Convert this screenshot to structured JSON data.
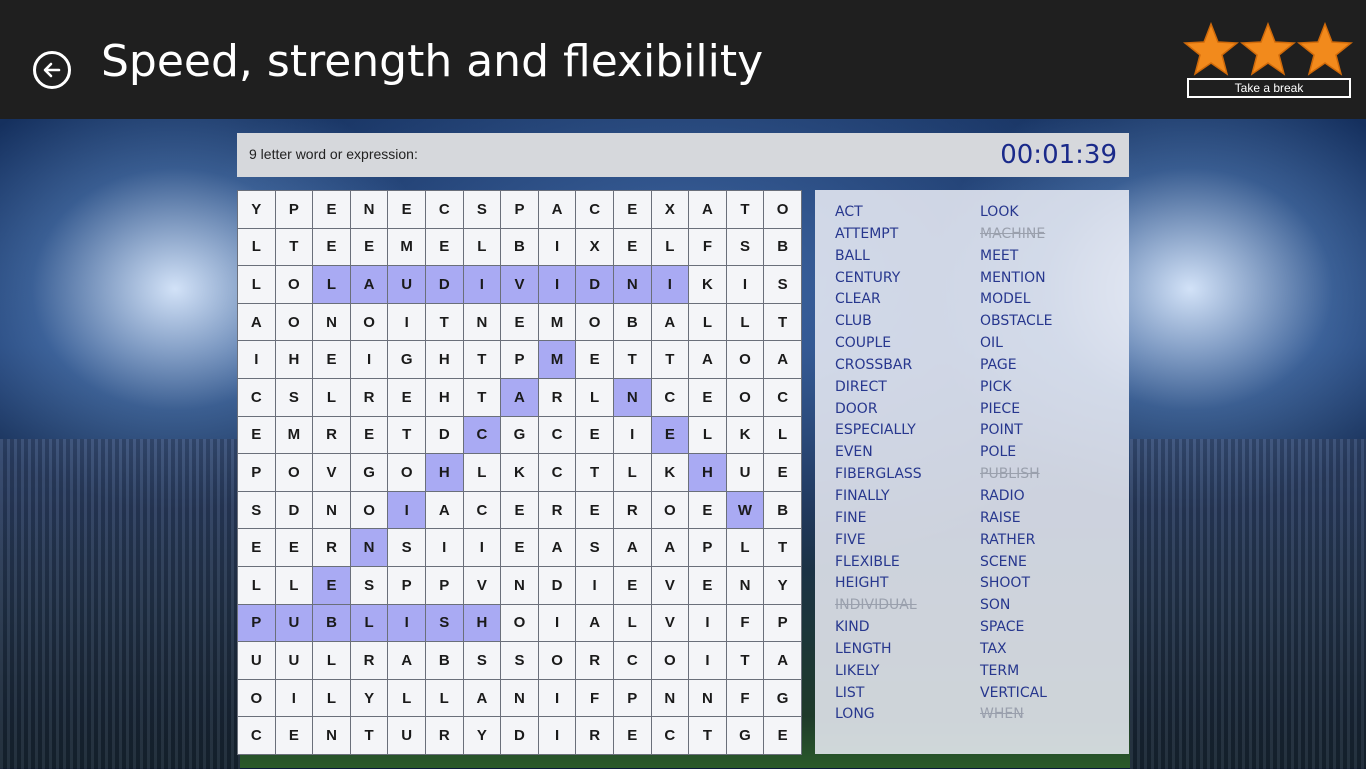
{
  "header": {
    "title": "Speed, strength and flexibility",
    "break_label": "Take a break",
    "stars": [
      "star-icon",
      "star-icon",
      "star-icon"
    ],
    "star_color": "#f28a1c"
  },
  "clue": {
    "text": "9 letter word or expression:",
    "timer": "00:01:39"
  },
  "grid": [
    "YPENECSPACEXATO",
    "LTEEMELBIXELFSB",
    "LOLAUDIVIDNIKIS",
    "AONOITNEMOBALLT",
    "IHEIGHTPMETTAOA",
    "CSLREHTARLNCEOC",
    "EMRETDCGCEIELKL",
    "POVGOHLKCTLKHUE",
    "SDNOIACEREROEWB",
    "EERNSIIEASAAPLT",
    "LLESPPVNDIEVENY",
    "PUBLISHOIALVIFP",
    "UULRABSSORCOITA",
    "OILYLLANIFPNNFG",
    "CENTURYDIRECTGE"
  ],
  "highlighted": [
    [
      2,
      2
    ],
    [
      2,
      3
    ],
    [
      2,
      4
    ],
    [
      2,
      5
    ],
    [
      2,
      6
    ],
    [
      2,
      7
    ],
    [
      2,
      8
    ],
    [
      2,
      9
    ],
    [
      2,
      10
    ],
    [
      2,
      11
    ],
    [
      4,
      8
    ],
    [
      5,
      7
    ],
    [
      5,
      10
    ],
    [
      6,
      6
    ],
    [
      6,
      11
    ],
    [
      7,
      5
    ],
    [
      7,
      12
    ],
    [
      8,
      4
    ],
    [
      8,
      13
    ],
    [
      9,
      3
    ],
    [
      10,
      2
    ],
    [
      11,
      0
    ],
    [
      11,
      1
    ],
    [
      11,
      2
    ],
    [
      11,
      3
    ],
    [
      11,
      4
    ],
    [
      11,
      5
    ],
    [
      11,
      6
    ]
  ],
  "words_col1": [
    {
      "w": "ACT",
      "found": false
    },
    {
      "w": "ATTEMPT",
      "found": false
    },
    {
      "w": "BALL",
      "found": false
    },
    {
      "w": "CENTURY",
      "found": false
    },
    {
      "w": "CLEAR",
      "found": false
    },
    {
      "w": "CLUB",
      "found": false
    },
    {
      "w": "COUPLE",
      "found": false
    },
    {
      "w": "CROSSBAR",
      "found": false
    },
    {
      "w": "DIRECT",
      "found": false
    },
    {
      "w": "DOOR",
      "found": false
    },
    {
      "w": "ESPECIALLY",
      "found": false
    },
    {
      "w": "EVEN",
      "found": false
    },
    {
      "w": "FIBERGLASS",
      "found": false
    },
    {
      "w": "FINALLY",
      "found": false
    },
    {
      "w": "FINE",
      "found": false
    },
    {
      "w": "FIVE",
      "found": false
    },
    {
      "w": "FLEXIBLE",
      "found": false
    },
    {
      "w": "HEIGHT",
      "found": false
    },
    {
      "w": "INDIVIDUAL",
      "found": true
    },
    {
      "w": "KIND",
      "found": false
    },
    {
      "w": "LENGTH",
      "found": false
    },
    {
      "w": "LIKELY",
      "found": false
    },
    {
      "w": "LIST",
      "found": false
    },
    {
      "w": "LONG",
      "found": false
    }
  ],
  "words_col2": [
    {
      "w": "LOOK",
      "found": false
    },
    {
      "w": "MACHINE",
      "found": true
    },
    {
      "w": "MEET",
      "found": false
    },
    {
      "w": "MENTION",
      "found": false
    },
    {
      "w": "MODEL",
      "found": false
    },
    {
      "w": "OBSTACLE",
      "found": false
    },
    {
      "w": "OIL",
      "found": false
    },
    {
      "w": "PAGE",
      "found": false
    },
    {
      "w": "PICK",
      "found": false
    },
    {
      "w": "PIECE",
      "found": false
    },
    {
      "w": "POINT",
      "found": false
    },
    {
      "w": "POLE",
      "found": false
    },
    {
      "w": "PUBLISH",
      "found": true
    },
    {
      "w": "RADIO",
      "found": false
    },
    {
      "w": "RAISE",
      "found": false
    },
    {
      "w": "RATHER",
      "found": false
    },
    {
      "w": "SCENE",
      "found": false
    },
    {
      "w": "SHOOT",
      "found": false
    },
    {
      "w": "SON",
      "found": false
    },
    {
      "w": "SPACE",
      "found": false
    },
    {
      "w": "TAX",
      "found": false
    },
    {
      "w": "TERM",
      "found": false
    },
    {
      "w": "VERTICAL",
      "found": false
    },
    {
      "w": "WHEN",
      "found": true
    }
  ],
  "icons": {
    "back": "back-arrow-icon"
  }
}
